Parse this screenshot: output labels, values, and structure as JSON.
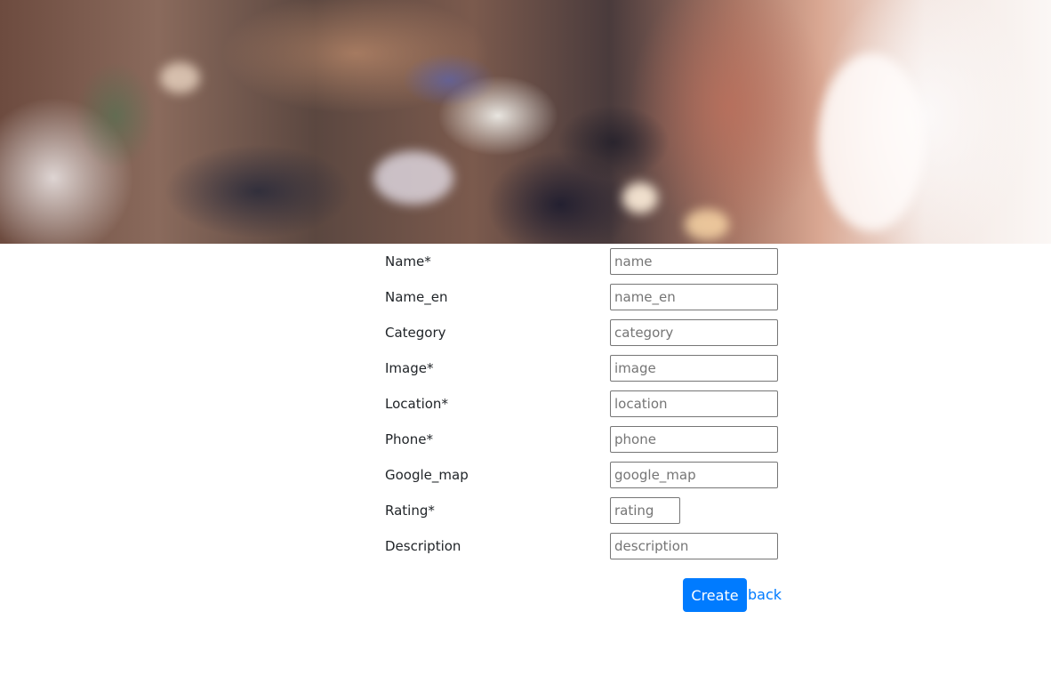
{
  "form": {
    "fields": [
      {
        "label": "Name*",
        "placeholder": "name"
      },
      {
        "label": "Name_en",
        "placeholder": "name_en"
      },
      {
        "label": "Category",
        "placeholder": "category"
      },
      {
        "label": "Image*",
        "placeholder": "image"
      },
      {
        "label": "Location*",
        "placeholder": "location"
      },
      {
        "label": "Phone*",
        "placeholder": "phone"
      },
      {
        "label": "Google_map",
        "placeholder": "google_map"
      },
      {
        "label": "Rating*",
        "placeholder": "rating"
      },
      {
        "label": "Description",
        "placeholder": "description"
      }
    ],
    "create_label": "Create",
    "back_label": "back"
  },
  "colors": {
    "primary": "#007bff",
    "text": "#212529",
    "input_border": "#767676"
  }
}
